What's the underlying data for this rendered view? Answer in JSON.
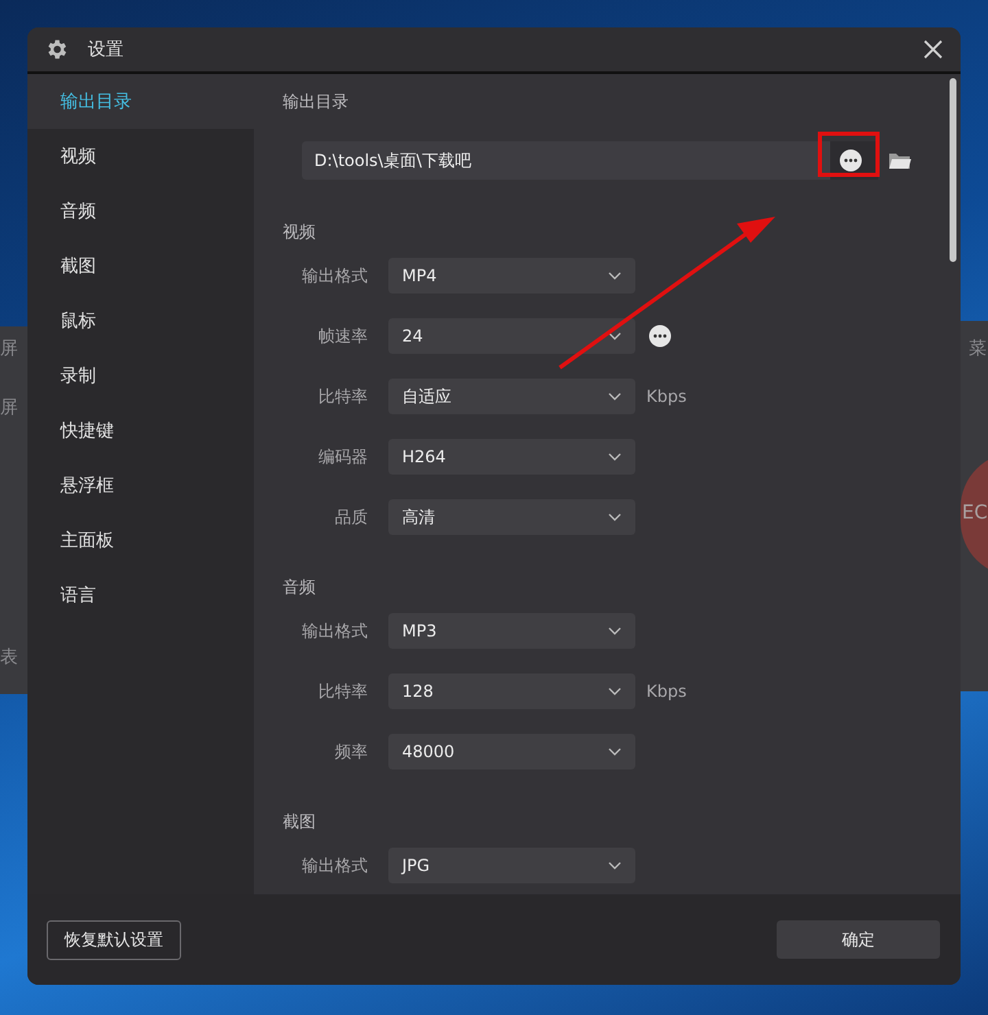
{
  "background_app": {
    "left_labels": [
      "屏",
      "屏",
      "表"
    ],
    "right_labels": [
      "菜"
    ],
    "record_label": "EC"
  },
  "window": {
    "title": "设置"
  },
  "sidebar": {
    "items": [
      {
        "label": "输出目录",
        "selected": true
      },
      {
        "label": "视频",
        "selected": false
      },
      {
        "label": "音频",
        "selected": false
      },
      {
        "label": "截图",
        "selected": false
      },
      {
        "label": "鼠标",
        "selected": false
      },
      {
        "label": "录制",
        "selected": false
      },
      {
        "label": "快捷键",
        "selected": false
      },
      {
        "label": "悬浮框",
        "selected": false
      },
      {
        "label": "主面板",
        "selected": false
      },
      {
        "label": "语言",
        "selected": false
      }
    ]
  },
  "output_dir": {
    "heading": "输出目录",
    "path": "D:\\tools\\桌面\\下载吧"
  },
  "sections": [
    {
      "heading": "视频",
      "rows": [
        {
          "label": "输出格式",
          "value": "MP4"
        },
        {
          "label": "帧速率",
          "value": "24",
          "more_button": true
        },
        {
          "label": "比特率",
          "value": "自适应",
          "unit": "Kbps"
        },
        {
          "label": "编码器",
          "value": "H264"
        },
        {
          "label": "品质",
          "value": "高清"
        }
      ]
    },
    {
      "heading": "音频",
      "rows": [
        {
          "label": "输出格式",
          "value": "MP3"
        },
        {
          "label": "比特率",
          "value": "128",
          "unit": "Kbps"
        },
        {
          "label": "频率",
          "value": "48000"
        }
      ]
    },
    {
      "heading": "截图",
      "rows": [
        {
          "label": "输出格式",
          "value": "JPG"
        }
      ]
    }
  ],
  "footer": {
    "reset_button": "恢复默认设置",
    "ok_button": "确定"
  }
}
